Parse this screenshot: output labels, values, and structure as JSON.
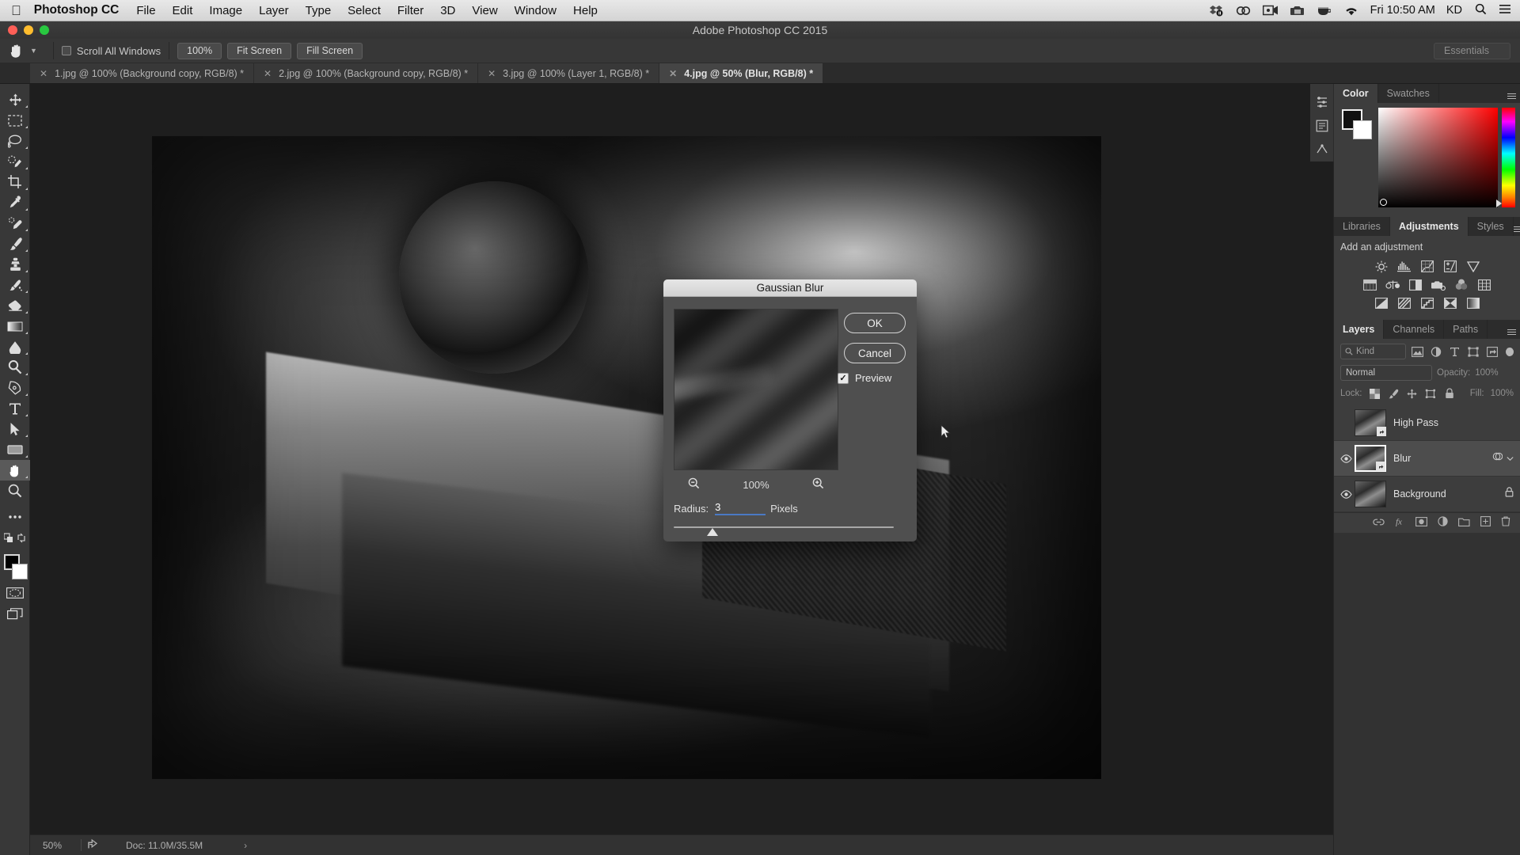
{
  "macbar": {
    "apple_icon": "apple-logo-icon",
    "app_name": "Photoshop CC",
    "menus": [
      "File",
      "Edit",
      "Image",
      "Layer",
      "Type",
      "Select",
      "Filter",
      "3D",
      "View",
      "Window",
      "Help"
    ],
    "status_icons": [
      "dropbox-icon",
      "creative-cloud-icon",
      "screen-record-icon",
      "camera-icon",
      "coffee-icon",
      "wifi-icon"
    ],
    "clock": "Fri 10:50 AM",
    "user": "KD",
    "search_icon": "search-icon",
    "list_icon": "control-center-icon"
  },
  "window": {
    "title": "Adobe Photoshop CC 2015"
  },
  "options_bar": {
    "tool_icon": "hand-tool-icon",
    "preset_caret": "chevron-down-icon",
    "scroll_all_windows_label": "Scroll All Windows",
    "scroll_all_windows_checked": false,
    "buttons": [
      "100%",
      "Fit Screen",
      "Fill Screen"
    ],
    "workspace_label": "Essentials"
  },
  "tabs": [
    {
      "label": "1.jpg @ 100% (Background copy, RGB/8) *",
      "active": false
    },
    {
      "label": "2.jpg @ 100% (Background copy, RGB/8) *",
      "active": false
    },
    {
      "label": "3.jpg @ 100% (Layer 1, RGB/8) *",
      "active": false
    },
    {
      "label": "4.jpg @ 50% (Blur, RGB/8) *",
      "active": true
    }
  ],
  "toolbar": {
    "tools": [
      {
        "name": "move-tool-icon",
        "selected": false
      },
      {
        "name": "rectangular-marquee-tool-icon",
        "selected": false
      },
      {
        "name": "lasso-tool-icon",
        "selected": false
      },
      {
        "name": "quick-selection-tool-icon",
        "selected": false
      },
      {
        "name": "crop-tool-icon",
        "selected": false
      },
      {
        "name": "eyedropper-tool-icon",
        "selected": false
      },
      {
        "name": "spot-healing-brush-tool-icon",
        "selected": false
      },
      {
        "name": "brush-tool-icon",
        "selected": false
      },
      {
        "name": "clone-stamp-tool-icon",
        "selected": false
      },
      {
        "name": "history-brush-tool-icon",
        "selected": false
      },
      {
        "name": "eraser-tool-icon",
        "selected": false
      },
      {
        "name": "gradient-tool-icon",
        "selected": false
      },
      {
        "name": "blur-tool-icon",
        "selected": false
      },
      {
        "name": "dodge-tool-icon",
        "selected": false
      },
      {
        "name": "pen-tool-icon",
        "selected": false
      },
      {
        "name": "type-tool-icon",
        "selected": false
      },
      {
        "name": "path-selection-tool-icon",
        "selected": false
      },
      {
        "name": "rectangle-tool-icon",
        "selected": false
      },
      {
        "name": "hand-tool-icon",
        "selected": true
      },
      {
        "name": "zoom-tool-icon",
        "selected": false
      },
      {
        "name": "more-tools-icon",
        "selected": false
      },
      {
        "name": "edit-toolbar-icon",
        "selected": false
      }
    ],
    "foreground_color": "#000000",
    "background_color": "#ffffff",
    "quick_mask_icon": "quick-mask-icon",
    "screen_mode_icon": "screen-mode-icon"
  },
  "dialog": {
    "title": "Gaussian Blur",
    "ok_label": "OK",
    "cancel_label": "Cancel",
    "preview_label": "Preview",
    "preview_checked": true,
    "zoom_out_icon": "zoom-out-icon",
    "zoom_in_icon": "zoom-in-icon",
    "zoom_level": "100%",
    "radius_label": "Radius:",
    "radius_value": "3",
    "radius_units": "Pixels",
    "accent_color": "#4a79c4"
  },
  "panels": {
    "collapse_icons": [
      "history-panel-icon",
      "properties-panel-icon",
      "actions-panel-icon"
    ],
    "color": {
      "tabs": [
        {
          "label": "Color",
          "active": true
        },
        {
          "label": "Swatches",
          "active": false
        }
      ],
      "menu_icon": "panel-menu-icon",
      "foreground_color": "#000000",
      "background_color": "#ffffff",
      "field_base_color": "#ff0000"
    },
    "adjustments": {
      "tabs": [
        {
          "label": "Libraries",
          "active": false
        },
        {
          "label": "Adjustments",
          "active": true
        },
        {
          "label": "Styles",
          "active": false
        }
      ],
      "menu_icon": "panel-menu-icon",
      "heading": "Add an adjustment",
      "row1": [
        "brightness-contrast-icon",
        "levels-icon",
        "curves-icon",
        "exposure-icon",
        "vibrance-icon"
      ],
      "row2": [
        "hue-saturation-icon",
        "color-balance-icon",
        "black-white-icon",
        "photo-filter-icon",
        "channel-mixer-icon",
        "color-lookup-icon"
      ],
      "row3": [
        "invert-icon",
        "posterize-icon",
        "threshold-icon",
        "selective-color-icon",
        "gradient-map-icon"
      ]
    },
    "layers": {
      "tabs": [
        {
          "label": "Layers",
          "active": true
        },
        {
          "label": "Channels",
          "active": false
        },
        {
          "label": "Paths",
          "active": false
        }
      ],
      "menu_icon": "panel-menu-icon",
      "filter_search_icon": "search-icon",
      "filter_kind": "Kind",
      "filter_icons": [
        "pixel-layer-filter-icon",
        "adjustment-layer-filter-icon",
        "type-layer-filter-icon",
        "shape-layer-filter-icon",
        "smart-object-filter-icon"
      ],
      "filter_toggle": "filter-toggle-icon",
      "blend_mode": "Normal",
      "opacity_label": "Opacity:",
      "opacity_value": "100%",
      "lock_label": "Lock:",
      "lock_icons": [
        "lock-transparent-pixels-icon",
        "lock-image-pixels-icon",
        "lock-position-icon",
        "lock-artboard-icon",
        "lock-all-icon"
      ],
      "fill_label": "Fill:",
      "fill_value": "100%",
      "items": [
        {
          "name": "High Pass",
          "visible": false,
          "selected": false,
          "smart_object": true,
          "locked": false,
          "has_fx": false
        },
        {
          "name": "Blur",
          "visible": true,
          "selected": true,
          "smart_object": true,
          "locked": false,
          "has_fx": true
        },
        {
          "name": "Background",
          "visible": true,
          "selected": false,
          "smart_object": false,
          "locked": true,
          "has_fx": false
        }
      ],
      "footer_icons": [
        "link-layers-icon",
        "layer-style-icon",
        "layer-mask-icon",
        "new-group-icon",
        "new-layer-icon",
        "delete-layer-icon"
      ]
    }
  },
  "statusbar": {
    "zoom": "50%",
    "share_icon": "share-icon",
    "doc_info": "Doc: 11.0M/35.5M",
    "chevron": "›"
  }
}
